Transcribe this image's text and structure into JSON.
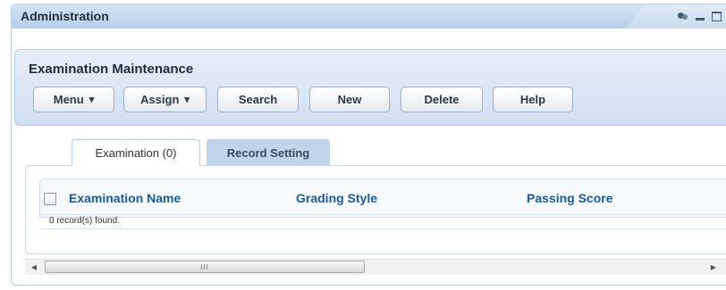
{
  "portlet": {
    "title": "Administration"
  },
  "panel": {
    "title": "Examination Maintenance",
    "buttons": {
      "menu": "Menu",
      "assign": "Assign",
      "search": "Search",
      "new": "New",
      "delete": "Delete",
      "help": "Help"
    }
  },
  "tabs": [
    {
      "label": "Examination (0)",
      "active": true
    },
    {
      "label": "Record Setting",
      "active": false
    }
  ],
  "grid": {
    "columns": [
      "Examination Name",
      "Grading Style",
      "Passing Score"
    ],
    "count_text": "0 record(s) found."
  },
  "scrollbar": {
    "grip": "III"
  },
  "icons": {
    "dropdown": "▾",
    "left": "◀",
    "right": "▶"
  }
}
